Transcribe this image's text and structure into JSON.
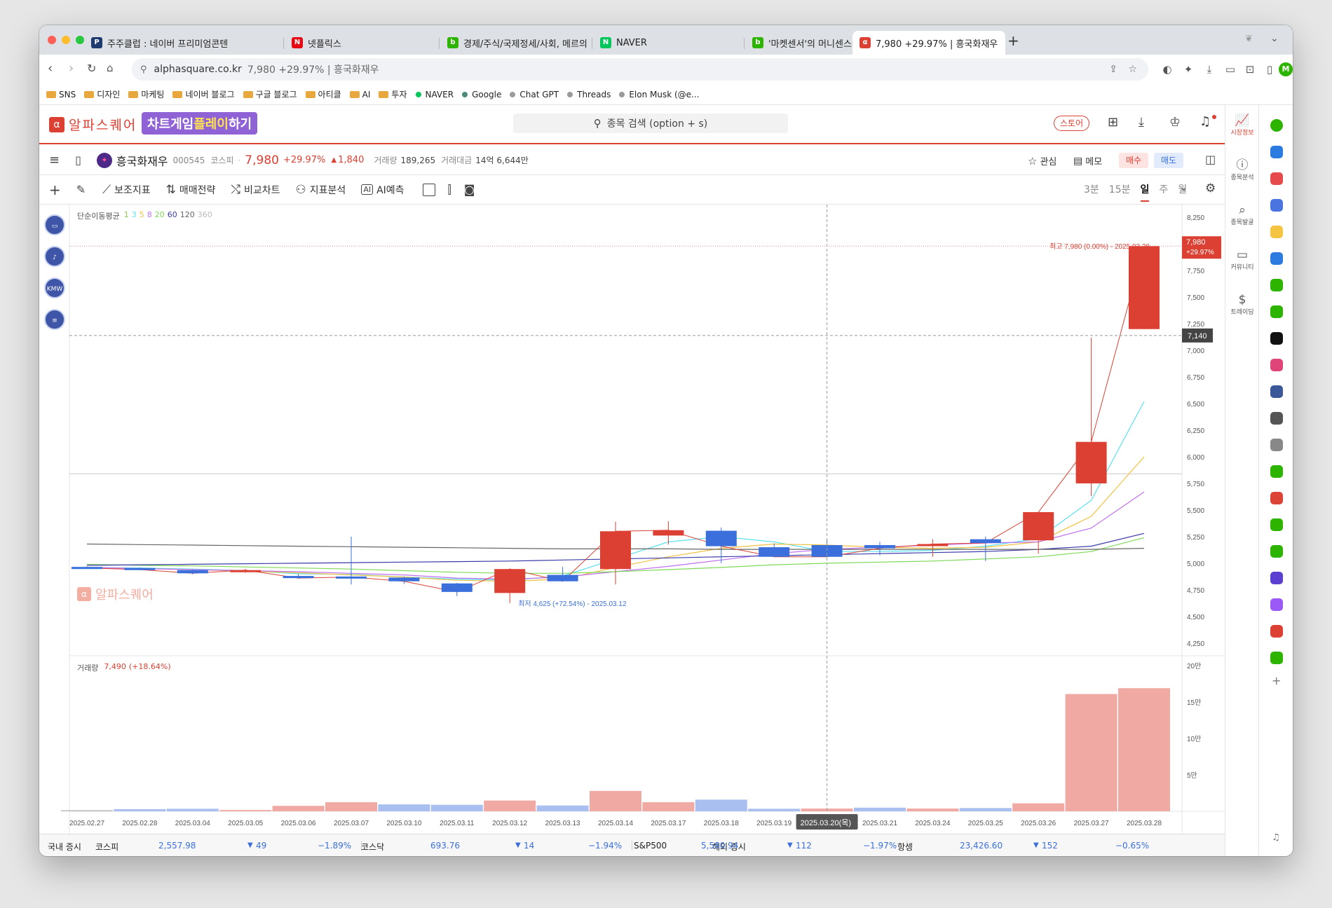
{
  "browser": {
    "tabs": [
      {
        "label": "주주클럽 : 네이버 프리미엄콘텐",
        "icon_color": "#1e3a6e",
        "icon_text": "P"
      },
      {
        "label": "넷플릭스",
        "icon_color": "#e50914",
        "icon_text": "N"
      },
      {
        "label": "경제/주식/국제정세/사회, 메르의",
        "icon_color": "#2db400",
        "icon_text": "b"
      },
      {
        "label": "NAVER",
        "icon_color": "#03c75a",
        "icon_text": "N"
      },
      {
        "label": "'마켓센서'의 머니센스를 높이는",
        "icon_color": "#2db400",
        "icon_text": "b"
      },
      {
        "label": "7,980 +29.97% | 흥국화재우",
        "icon_color": "#dc4032",
        "icon_text": "α"
      }
    ],
    "new_tab": "+",
    "url_host": "alphasquare.co.kr",
    "url_title": "7,980 +29.97% | 흥국화재우",
    "bookmarks": [
      {
        "label": "SNS",
        "kind": "folder"
      },
      {
        "label": "디자인",
        "kind": "folder"
      },
      {
        "label": "마케팅",
        "kind": "folder"
      },
      {
        "label": "네이버 블로그",
        "kind": "folder"
      },
      {
        "label": "구글 블로그",
        "kind": "folder"
      },
      {
        "label": "아티클",
        "kind": "folder"
      },
      {
        "label": "AI",
        "kind": "folder"
      },
      {
        "label": "투자",
        "kind": "folder"
      },
      {
        "label": "NAVER",
        "kind": "site",
        "color": "#03c75a"
      },
      {
        "label": "Google",
        "kind": "site",
        "color": "#4a8a7a"
      },
      {
        "label": "Chat GPT",
        "kind": "site",
        "color": "#9a9a9a"
      },
      {
        "label": "Threads",
        "kind": "site",
        "color": "#9a9a9a"
      },
      {
        "label": "Elon Musk (@e...",
        "kind": "site",
        "color": "#9a9a9a"
      }
    ],
    "profile_letter": "M"
  },
  "app": {
    "logo_text": "알파스퀘어",
    "game_banner": {
      "part1": "차트게임 ",
      "part2": "플레이",
      "part3": "하기"
    },
    "search_placeholder": "종목 검색 (option + s)",
    "store_label": "스토어",
    "accent": "#dc4032"
  },
  "stock": {
    "name": "흥국화재우",
    "code": "000545",
    "market": "코스피",
    "price": "7,980",
    "change_pct": "+29.97%",
    "change_abs": "1,840",
    "volume_label": "거래량",
    "volume": "189,265",
    "amount_label": "거래대금",
    "amount": "14억 6,644만",
    "watch_label": "관심",
    "memo_label": "메모",
    "buy_label": "매수",
    "sell_label": "매도"
  },
  "toolbar": {
    "items": [
      "보조지표",
      "매매전략",
      "비교차트",
      "지표분석",
      "AI예측"
    ],
    "periods": [
      "3분",
      "15분",
      "일",
      "주",
      "월"
    ],
    "active_period": "일"
  },
  "chart_data": {
    "type": "candlestick",
    "ma_title": "단순이동평균",
    "ma_periods": [
      {
        "label": "1",
        "color": "#8bc34a"
      },
      {
        "label": "3",
        "color": "#5ce0f0"
      },
      {
        "label": "5",
        "color": "#f0c040"
      },
      {
        "label": "8",
        "color": "#c070f0"
      },
      {
        "label": "20",
        "color": "#7ed957"
      },
      {
        "label": "60",
        "color": "#3a3aa8"
      },
      {
        "label": "120",
        "color": "#666666"
      },
      {
        "label": "360",
        "color": "#bbbbbb"
      }
    ],
    "dates": [
      "2025.02.27",
      "2025.02.28",
      "2025.03.04",
      "2025.03.05",
      "2025.03.06",
      "2025.03.07",
      "2025.03.10",
      "2025.03.11",
      "2025.03.12",
      "2025.03.13",
      "2025.03.14",
      "2025.03.17",
      "2025.03.18",
      "2025.03.19",
      "2025.03.20",
      "2025.03.21",
      "2025.03.24",
      "2025.03.25",
      "2025.03.26",
      "2025.03.27",
      "2025.03.28"
    ],
    "ohlc": [
      [
        4965,
        4970,
        4955,
        4955
      ],
      [
        4955,
        4960,
        4935,
        4940
      ],
      [
        4935,
        4940,
        4895,
        4905
      ],
      [
        4920,
        4945,
        4910,
        4935
      ],
      [
        4880,
        4900,
        4855,
        4860
      ],
      [
        4875,
        5250,
        4800,
        4870
      ],
      [
        4865,
        4875,
        4805,
        4830
      ],
      [
        4810,
        4815,
        4690,
        4730
      ],
      [
        4720,
        4950,
        4625,
        4945
      ],
      [
        4890,
        4965,
        4860,
        4830
      ],
      [
        4945,
        5390,
        4800,
        5300
      ],
      [
        5260,
        5395,
        5175,
        5310
      ],
      [
        5305,
        5335,
        5000,
        5160
      ],
      [
        5150,
        5185,
        5060,
        5060
      ],
      [
        5170,
        5230,
        5080,
        5060
      ],
      [
        5170,
        5200,
        5075,
        5140
      ],
      [
        5175,
        5225,
        5060,
        5180
      ],
      [
        5225,
        5250,
        5020,
        5190
      ],
      [
        5215,
        5215,
        5090,
        5480
      ],
      [
        5750,
        7120,
        5630,
        6140
      ],
      [
        7200,
        7980,
        7200,
        7980
      ]
    ],
    "ma_series": [
      {
        "name": "3",
        "color": "#5ce0f0",
        "values": [
          4960,
          4955,
          4945,
          4930,
          4900,
          4895,
          4870,
          4850,
          4840,
          4880,
          5040,
          5200,
          5250,
          5200,
          5110,
          5110,
          5120,
          5160,
          5230,
          5590,
          6520
        ]
      },
      {
        "name": "5",
        "color": "#f0c040",
        "values": [
          4960,
          4950,
          4940,
          4925,
          4910,
          4890,
          4870,
          4840,
          4830,
          4850,
          4960,
          5060,
          5140,
          5180,
          5170,
          5150,
          5140,
          5150,
          5200,
          5440,
          6000
        ]
      },
      {
        "name": "8",
        "color": "#c070f0",
        "values": [
          4960,
          4950,
          4940,
          4930,
          4920,
          4905,
          4890,
          4860,
          4850,
          4870,
          4920,
          4970,
          5030,
          5090,
          5130,
          5150,
          5170,
          5190,
          5200,
          5330,
          5670
        ]
      },
      {
        "name": "20",
        "color": "#7ed957",
        "values": [
          4990,
          4980,
          4975,
          4965,
          4955,
          4945,
          4930,
          4915,
          4905,
          4905,
          4920,
          4940,
          4960,
          4985,
          5000,
          5010,
          5020,
          5040,
          5060,
          5110,
          5240
        ]
      },
      {
        "name": "60",
        "color": "#3a3aa8",
        "values": [
          4980,
          4985,
          4990,
          4995,
          5000,
          5005,
          5010,
          5015,
          5020,
          5030,
          5040,
          5050,
          5060,
          5070,
          5080,
          5090,
          5100,
          5110,
          5130,
          5160,
          5280
        ]
      },
      {
        "name": "120",
        "color": "#666666",
        "values": [
          5180,
          5175,
          5170,
          5165,
          5160,
          5155,
          5150,
          5145,
          5140,
          5135,
          5135,
          5135,
          5130,
          5130,
          5130,
          5130,
          5130,
          5130,
          5130,
          5130,
          5140
        ]
      },
      {
        "name": "1",
        "color": "#dc4032",
        "values": [
          4955,
          4940,
          4905,
          4935,
          4860,
          4870,
          4830,
          4730,
          4945,
          4830,
          5300,
          5310,
          5160,
          5060,
          5060,
          5140,
          5180,
          5190,
          5480,
          6140,
          7980
        ]
      }
    ],
    "y_ticks": [
      "8,250",
      "8,000",
      "7,750",
      "7,500",
      "7,250",
      "7,000",
      "6,750",
      "6,500",
      "6,250",
      "6,000",
      "5,750",
      "5,500",
      "5,250",
      "5,000",
      "4,750",
      "4,500",
      "4,250"
    ],
    "y_ticks_values": [
      8250,
      8000,
      7750,
      7500,
      7250,
      7000,
      6750,
      6500,
      6250,
      6000,
      5750,
      5500,
      5250,
      5000,
      4750,
      4500,
      4250
    ],
    "ylim": [
      4130,
      8370
    ],
    "high_note": "최고 7,980 (0.00%) - 2025.03.28",
    "low_note": "최저 4,625 (+72.54%) - 2025.03.12",
    "last_tag": {
      "value": "7,980",
      "pct": "+29.97%"
    },
    "crosshair_tag": "7,140",
    "crosshair_date": "2025.03.20(목)",
    "crosshair_value": 7140,
    "crosshair_index": 14,
    "reference_line_value": 5840,
    "watermark": "알파스퀘어",
    "volume": {
      "title": "거래량",
      "last": "7,490",
      "last_pct": "(+18.64%)",
      "values": [
        1500,
        3000,
        3500,
        1800,
        7500,
        12500,
        9500,
        9000,
        14800,
        8000,
        28000,
        12500,
        16000,
        3500,
        3800,
        5000,
        3800,
        4500,
        11000,
        161000,
        169000
      ],
      "colors": [
        "gray",
        "blue",
        "blue",
        "red",
        "red",
        "red",
        "blue",
        "blue",
        "red",
        "blue",
        "red",
        "red",
        "blue",
        "blue",
        "red",
        "blue",
        "red",
        "blue",
        "red",
        "red",
        "red"
      ],
      "ticks": [
        "20만",
        "15만",
        "10만",
        "5만"
      ],
      "ticks_values": [
        200000,
        150000,
        100000,
        50000
      ],
      "max": 200000
    }
  },
  "bottombar": {
    "domestic_label": "국내 증시",
    "overseas_label": "해외 증시",
    "indices": [
      {
        "name": "코스피",
        "value": "2,557.98",
        "change": "49",
        "pct": "−1.89%"
      },
      {
        "name": "코스닥",
        "value": "693.76",
        "change": "14",
        "pct": "−1.94%"
      },
      {
        "name": "S&P500",
        "value": "5,580.94",
        "change": "112",
        "pct": "−1.97%"
      },
      {
        "name": "항셍",
        "value": "23,426.60",
        "change": "152",
        "pct": "−0.65%"
      }
    ]
  },
  "rightrail": [
    {
      "label": "시장정보",
      "icon": "chart-icon",
      "active": true
    },
    {
      "label": "종목분석",
      "icon": "info-icon",
      "active": false
    },
    {
      "label": "종목발굴",
      "icon": "search-chart-icon",
      "active": false
    },
    {
      "label": "커뮤니티",
      "icon": "chat-icon",
      "active": false
    },
    {
      "label": "트레이딩",
      "icon": "trading-icon",
      "active": false
    }
  ],
  "left_icons": [
    "monitor-icon",
    "music-note-icon",
    "kmw-icon",
    "logo-icon"
  ],
  "left_icon_texts": [
    "▭",
    "♪",
    "KMW",
    "≡"
  ]
}
